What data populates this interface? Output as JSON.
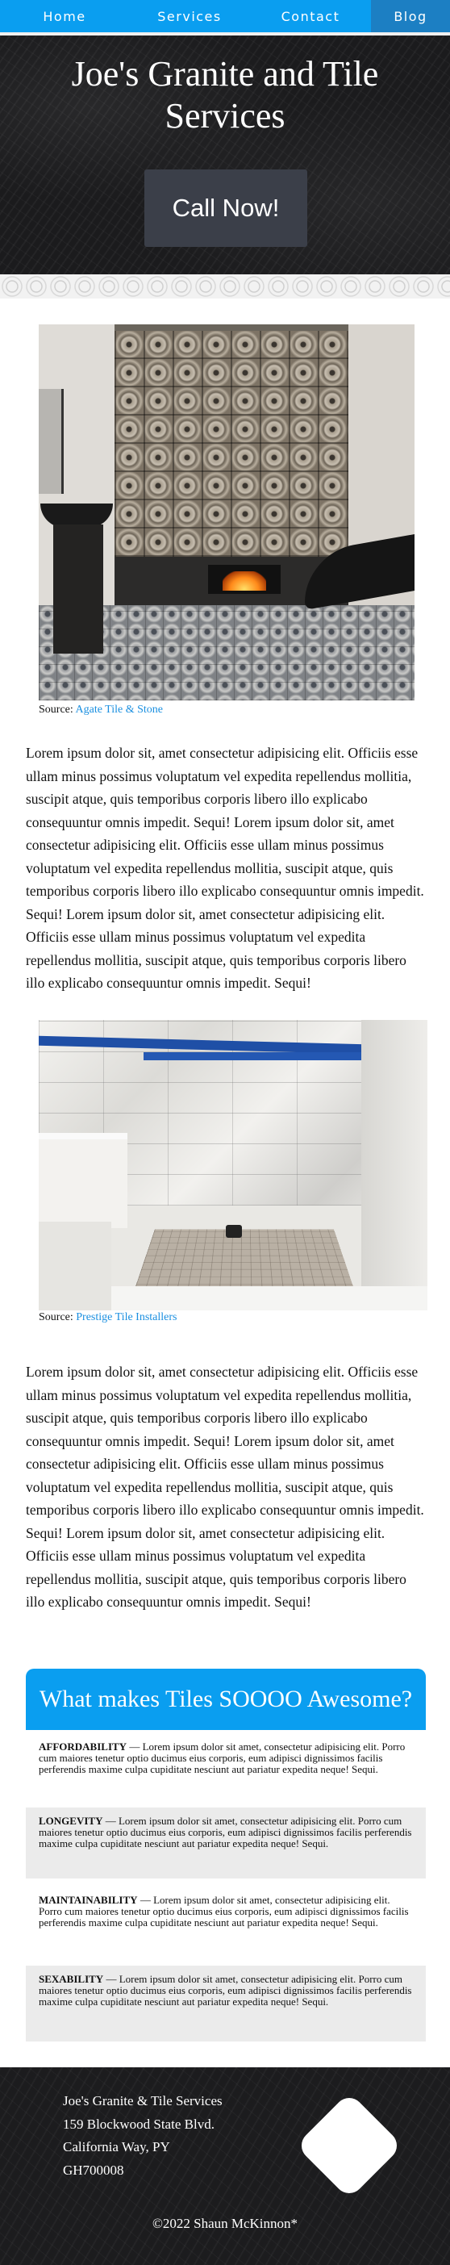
{
  "nav": {
    "items": [
      "Home",
      "Services",
      "Contact",
      "Blog"
    ],
    "active": "Blog",
    "color": "#0a9ef0",
    "active_color": "#1c7fc3"
  },
  "hero": {
    "title": "Joe's Granite and Tile Services",
    "cta_label": "Call Now!"
  },
  "images": [
    {
      "source_prefix": "Source: ",
      "source_link": "Agate Tile & Stone"
    },
    {
      "source_prefix": "Source: ",
      "source_link": "Prestige Tile Installers"
    }
  ],
  "paragraphs": [
    "Lorem ipsum dolor sit, amet consectetur adipisicing elit. Officiis esse ullam minus possimus voluptatum vel expedita repellendus mollitia, suscipit atque, quis temporibus corporis libero illo explicabo consequuntur omnis impedit. Sequi! Lorem ipsum dolor sit, amet consectetur adipisicing elit. Officiis esse ullam minus possimus voluptatum vel expedita repellendus mollitia, suscipit atque, quis temporibus corporis libero illo explicabo consequuntur omnis impedit. Sequi! Lorem ipsum dolor sit, amet consectetur adipisicing elit. Officiis esse ullam minus possimus voluptatum vel expedita repellendus mollitia, suscipit atque, quis temporibus corporis libero illo explicabo consequuntur omnis impedit. Sequi!",
    "Lorem ipsum dolor sit, amet consectetur adipisicing elit. Officiis esse ullam minus possimus voluptatum vel expedita repellendus mollitia, suscipit atque, quis temporibus corporis libero illo explicabo consequuntur omnis impedit. Sequi! Lorem ipsum dolor sit, amet consectetur adipisicing elit. Officiis esse ullam minus possimus voluptatum vel expedita repellendus mollitia, suscipit atque, quis temporibus corporis libero illo explicabo consequuntur omnis impedit. Sequi! Lorem ipsum dolor sit, amet consectetur adipisicing elit. Officiis esse ullam minus possimus voluptatum vel expedita repellendus mollitia, suscipit atque, quis temporibus corporis libero illo explicabo consequuntur omnis impedit. Sequi!"
  ],
  "why": {
    "heading": "What makes Tiles SOOOO Awesome?",
    "items": [
      {
        "title": "AFFORDABILITY",
        "text": " — Lorem ipsum dolor sit amet, consectetur adipisicing elit. Porro cum maiores tenetur optio ducimus eius corporis, eum adipisci dignissimos facilis perferendis maxime culpa cupiditate nesciunt aut pariatur expedita neque! Sequi."
      },
      {
        "title": "LONGEVITY",
        "text": " — Lorem ipsum dolor sit amet, consectetur adipisicing elit. Porro cum maiores tenetur optio ducimus eius corporis, eum adipisci dignissimos facilis perferendis maxime culpa cupiditate nesciunt aut pariatur expedita neque! Sequi."
      },
      {
        "title": "MAINTAINABILITY",
        "text": " — Lorem ipsum dolor sit amet, consectetur adipisicing elit. Porro cum maiores tenetur optio ducimus eius corporis, eum adipisci dignissimos facilis perferendis maxime culpa cupiditate nesciunt aut pariatur expedita neque! Sequi."
      },
      {
        "title": "SEXABILITY",
        "text": " — Lorem ipsum dolor sit amet, consectetur adipisicing elit. Porro cum maiores tenetur optio ducimus eius corporis, eum adipisci dignissimos facilis perferendis maxime culpa cupiditate nesciunt aut pariatur expedita neque! Sequi."
      }
    ]
  },
  "footer": {
    "address": [
      "Joe's Granite & Tile Services",
      "159 Blockwood State Blvd.",
      "California Way, PY",
      "GH700008"
    ],
    "copyright": "©2022 Shaun McKinnon*"
  }
}
